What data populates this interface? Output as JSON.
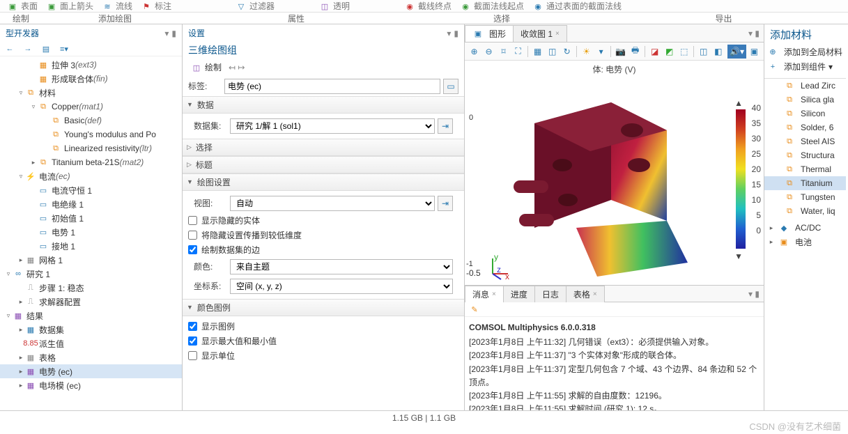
{
  "top_ribbon": {
    "items": [
      "表面",
      "面上箭头",
      "流线",
      "标注",
      "过滤器",
      "透明",
      "截线终点",
      "截面法线起点",
      "通过表面的截面法线"
    ],
    "groups": [
      "绘制",
      "添加绘图",
      "属性",
      "选择",
      "导出"
    ]
  },
  "model_builder": {
    "title": "型开发器",
    "items": [
      {
        "indent": 2,
        "tw": "",
        "ico": "▦",
        "cls": "ico-orange",
        "label": "拉伸 3",
        "suffix": "(ext3)"
      },
      {
        "indent": 2,
        "tw": "",
        "ico": "▦",
        "cls": "ico-orange",
        "label": "形成联合体",
        "suffix": "(fin)"
      },
      {
        "indent": 1,
        "tw": "▿",
        "ico": "⧉",
        "cls": "ico-orange",
        "label": "材料",
        "suffix": ""
      },
      {
        "indent": 2,
        "tw": "▿",
        "ico": "⧉",
        "cls": "ico-orange",
        "label": "Copper",
        "suffix": "(mat1)"
      },
      {
        "indent": 3,
        "tw": "",
        "ico": "⧉",
        "cls": "ico-orange",
        "label": "Basic",
        "suffix": "(def)"
      },
      {
        "indent": 3,
        "tw": "",
        "ico": "⧉",
        "cls": "ico-orange",
        "label": "Young's modulus and Po",
        "suffix": ""
      },
      {
        "indent": 3,
        "tw": "",
        "ico": "⧉",
        "cls": "ico-orange",
        "label": "Linearized resistivity",
        "suffix": "(ltr)"
      },
      {
        "indent": 2,
        "tw": "▸",
        "ico": "⧉",
        "cls": "ico-orange",
        "label": "Titanium beta-21S",
        "suffix": "(mat2)"
      },
      {
        "indent": 1,
        "tw": "▿",
        "ico": "⚡",
        "cls": "ico-red",
        "label": "电流",
        "suffix": "(ec)"
      },
      {
        "indent": 2,
        "tw": "",
        "ico": "▭",
        "cls": "ico-blue",
        "label": "电流守恒 1",
        "suffix": ""
      },
      {
        "indent": 2,
        "tw": "",
        "ico": "▭",
        "cls": "ico-blue",
        "label": "电绝缘 1",
        "suffix": ""
      },
      {
        "indent": 2,
        "tw": "",
        "ico": "▭",
        "cls": "ico-blue",
        "label": "初始值 1",
        "suffix": ""
      },
      {
        "indent": 2,
        "tw": "",
        "ico": "▭",
        "cls": "ico-blue",
        "label": "电势 1",
        "suffix": ""
      },
      {
        "indent": 2,
        "tw": "",
        "ico": "▭",
        "cls": "ico-blue",
        "label": "接地 1",
        "suffix": ""
      },
      {
        "indent": 1,
        "tw": "▸",
        "ico": "▦",
        "cls": "ico-gray",
        "label": "网格 1",
        "suffix": ""
      },
      {
        "indent": 0,
        "tw": "▿",
        "ico": "∞",
        "cls": "ico-blue",
        "label": "研究 1",
        "suffix": ""
      },
      {
        "indent": 1,
        "tw": "",
        "ico": "⎍",
        "cls": "ico-gray",
        "label": "步骤 1: 稳态",
        "suffix": ""
      },
      {
        "indent": 1,
        "tw": "▸",
        "ico": "⎍",
        "cls": "ico-gray",
        "label": "求解器配置",
        "suffix": ""
      },
      {
        "indent": 0,
        "tw": "▿",
        "ico": "▦",
        "cls": "ico-purple",
        "label": "结果",
        "suffix": ""
      },
      {
        "indent": 1,
        "tw": "▸",
        "ico": "▦",
        "cls": "ico-blue",
        "label": "数据集",
        "suffix": ""
      },
      {
        "indent": 1,
        "tw": "",
        "ico": "8.85",
        "cls": "ico-red",
        "label": "派生值",
        "suffix": ""
      },
      {
        "indent": 1,
        "tw": "▸",
        "ico": "▦",
        "cls": "ico-gray",
        "label": "表格",
        "suffix": ""
      },
      {
        "indent": 1,
        "tw": "▸",
        "ico": "▦",
        "cls": "ico-purple",
        "label": "电势 (ec)",
        "suffix": "",
        "sel": true
      },
      {
        "indent": 1,
        "tw": "▸",
        "ico": "▦",
        "cls": "ico-purple",
        "label": "电场模 (ec)",
        "suffix": ""
      }
    ]
  },
  "settings": {
    "title": "设置",
    "subtitle": "三维绘图组",
    "plot_btn": "绘制",
    "label_lbl": "标签:",
    "label_val": "电势 (ec)",
    "sect_data": "数据",
    "dataset_lbl": "数据集:",
    "dataset_val": "研究 1/解 1 (sol1)",
    "sect_select": "选择",
    "sect_title": "标题",
    "sect_plot": "绘图设置",
    "view_lbl": "视图:",
    "view_val": "自动",
    "chk1": "显示隐藏的实体",
    "chk2": "将隐藏设置传播到较低维度",
    "chk3": "绘制数据集的边",
    "color_lbl": "颜色:",
    "color_val": "来自主题",
    "coord_lbl": "坐标系:",
    "coord_val": "空间  (x, y, z)",
    "sect_legend": "颜色图例",
    "chk4": "显示图例",
    "chk5": "显示最大值和最小值",
    "chk6": "显示单位"
  },
  "graphics": {
    "tab1": "图形",
    "tab2": "收敛图 1",
    "plot_title": "体: 电势  (V)",
    "colorbar": [
      "40",
      "35",
      "30",
      "25",
      "20",
      "15",
      "10",
      "5",
      "0"
    ],
    "axis_ticks": [
      "0",
      "-0.5"
    ]
  },
  "messages": {
    "tabs": [
      "消息",
      "进度",
      "日志",
      "表格"
    ],
    "title_line": "COMSOL Multiphysics 6.0.0.318",
    "lines": [
      "[2023年1月8日  上午11:32] 几何错误（ext3）：必须提供输入对象。",
      "[2023年1月8日  上午11:37] \"3 个实体对象\"形成的联合体。",
      "[2023年1月8日  上午11:37] 定型几何包含 7 个域、43 个边界、84 条边和 52 个顶点。",
      "[2023年1月8日  上午11:55] 求解的自由度数：12196。",
      "[2023年1月8日  上午11:55] 求解时间 (研究 1): 12 s。"
    ]
  },
  "materials": {
    "title": "添加材料",
    "add_global": "添加到全局材料",
    "add_comp": "添加到组件",
    "list": [
      "Lead Zirc",
      "Silica gla",
      "Silicon",
      "Solder, 6",
      "Steel AIS",
      "Structura",
      "Thermal",
      "Titanium",
      "Tungsten",
      "Water, liq"
    ],
    "libs": [
      "AC/DC",
      "电池"
    ]
  },
  "status": {
    "mem": "1.15 GB | 1.1 GB"
  },
  "watermark": "CSDN @没有艺术细菌"
}
